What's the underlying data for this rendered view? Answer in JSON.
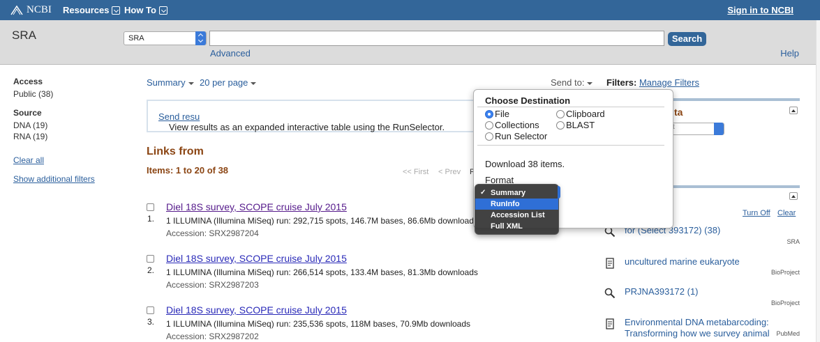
{
  "topbar": {
    "logo": "NCBI",
    "menu_resources": "Resources",
    "menu_howto": "How To",
    "signin": "Sign in to NCBI"
  },
  "searchbar": {
    "db_title": "SRA",
    "db_select": "SRA",
    "search_button": "Search",
    "advanced": "Advanced",
    "help": "Help",
    "term": ""
  },
  "sidebar": {
    "access_heading": "Access",
    "access_items": [
      "Public (38)"
    ],
    "source_heading": "Source",
    "source_items": [
      "DNA (19)",
      "RNA (19)"
    ],
    "clear_all": "Clear all",
    "show_filters": "Show additional filters"
  },
  "toolbar": {
    "summary": "Summary",
    "per_page": "20 per page",
    "send_to": "Send to:",
    "filters": "Filters:",
    "manage_filters": "Manage Filters"
  },
  "notice": {
    "text": "View results as an expanded interactive table using the RunSelector.",
    "link": "Send resu"
  },
  "results": {
    "links_from": "Links from",
    "items": "Items: 1 to 20 of 38",
    "pager_first": "<< First",
    "pager_prev": "< Prev",
    "pager_partial": "P",
    "list": [
      {
        "num": "1.",
        "title": "Diel 18S survey, SCOPE cruise July 2015",
        "desc": "1 ILLUMINA (Illumina MiSeq) run: 292,715 spots, 146.7M bases, 86.6Mb download",
        "accession": "Accession: SRX2987204"
      },
      {
        "num": "2.",
        "title": "Diel 18S survey, SCOPE cruise July 2015",
        "desc": "1 ILLUMINA (Illumina MiSeq) run: 266,514 spots, 133.4M bases, 81.3Mb downloads",
        "accession": "Accession: SRX2987203"
      },
      {
        "num": "3.",
        "title": "Diel 18S survey, SCOPE cruise July 2015",
        "desc": "1 ILLUMINA (Illumina MiSeq) run: 235,536 spots, 118M bases, 70.9Mb downloads",
        "accession": "Accession: SRX2987202"
      }
    ]
  },
  "right": {
    "partial_heading": "ta",
    "partial_select": "t",
    "turn_off": "Turn Off",
    "clear": "Clear",
    "recent": [
      {
        "icon": "search-icon",
        "text": "for (Select 393172) (38)",
        "source": "SRA"
      },
      {
        "icon": "document-icon",
        "text": "uncultured marine eukaryote",
        "source": "BioProject"
      },
      {
        "icon": "search-icon",
        "text": "PRJNA393172 (1)",
        "source": "BioProject"
      },
      {
        "icon": "document-icon",
        "text": "Environmental DNA metabarcoding: Transforming how we survey animal",
        "source": "PubMed"
      }
    ]
  },
  "popup": {
    "heading": "Choose Destination",
    "options": {
      "file": "File",
      "clipboard": "Clipboard",
      "collections": "Collections",
      "blast": "BLAST",
      "run_selector": "Run Selector"
    },
    "selected": "File",
    "download": "Download 38 items.",
    "format_label": "Format"
  },
  "format_menu": {
    "items": [
      "Summary",
      "RunInfo",
      "Accession List",
      "Full XML"
    ],
    "checked": "Summary",
    "highlighted": "RunInfo"
  },
  "colors": {
    "header": "#336699",
    "link": "#2a5e9c",
    "heading_brown": "#8b4513",
    "highlight": "#2f6fd6"
  }
}
